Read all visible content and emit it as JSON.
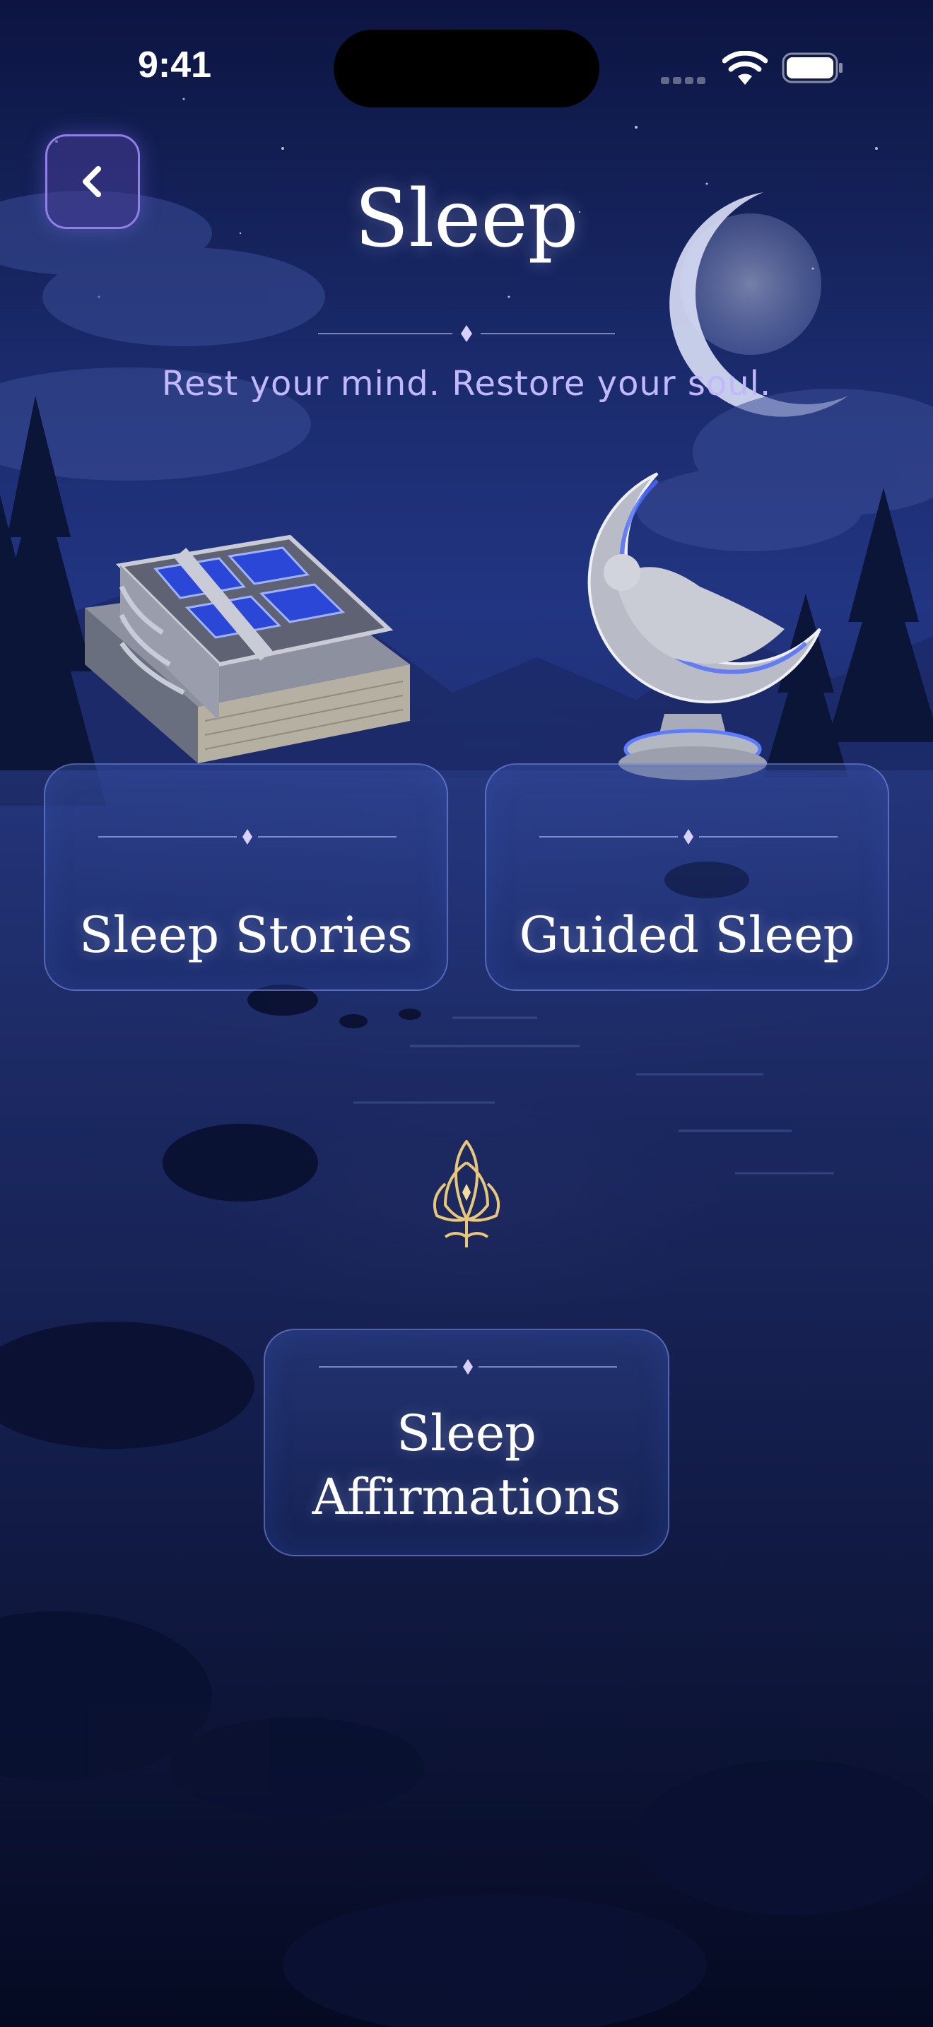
{
  "status_bar": {
    "time": "9:41",
    "icons": [
      "cellular-signal-icon",
      "wifi-icon",
      "battery-icon"
    ]
  },
  "header": {
    "back_icon": "chevron-left-icon",
    "title": "Sleep",
    "subtitle": "Rest your mind. Restore your soul."
  },
  "cards": [
    {
      "label": "Sleep Stories",
      "icon": "book-illustration"
    },
    {
      "label": "Guided Sleep",
      "icon": "crescent-moon-statue-illustration"
    },
    {
      "label_line1": "Sleep",
      "label_line2": "Affirmations",
      "icon": "lotus-icon"
    }
  ],
  "colors": {
    "background_top": "#0c1541",
    "background_bottom": "#060a22",
    "accent_lavender": "#c1b8ff",
    "back_button_border": "#8f7fe6",
    "card_border": "#96aaff",
    "lotus_gold": "#e8c77a"
  }
}
